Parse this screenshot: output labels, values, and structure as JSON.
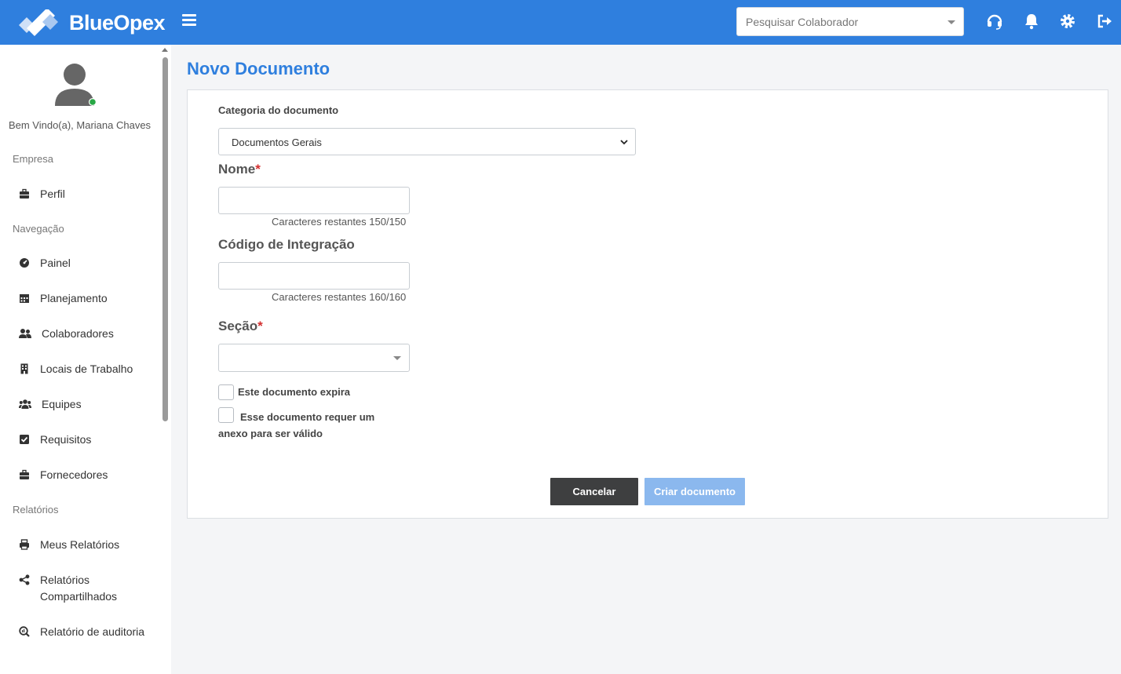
{
  "brand": {
    "name": "BlueOpex"
  },
  "header": {
    "search": {
      "placeholder": "Pesquisar Colaborador"
    },
    "icons": [
      "headset-icon",
      "bell-icon",
      "gear-icon",
      "logout-icon"
    ]
  },
  "sidebar": {
    "welcome": "Bem Vindo(a), Mariana Chaves",
    "sections": {
      "empresa": "Empresa",
      "navegacao": "Navegação",
      "relatorios": "Relatórios"
    },
    "items": {
      "perfil": "Perfil",
      "painel": "Painel",
      "planejamento": "Planejamento",
      "colaboradores": "Colaboradores",
      "locais": "Locais de Trabalho",
      "equipes": "Equipes",
      "requisitos": "Requisitos",
      "fornecedores": "Fornecedores",
      "meus_relatorios": "Meus Relatórios",
      "relatorios_compartilhados": "Relatórios Compartilhados",
      "relatorio_auditoria": "Relatório de auditoria"
    },
    "status_color": "#28a745"
  },
  "main": {
    "title": "Novo Documento",
    "form": {
      "categoria_label": "Categoria do documento",
      "categoria_value": "Documentos Gerais",
      "nome_label": "Nome",
      "nome_hint": "Caracteres restantes 150/150",
      "codigo_label": "Código de Integração",
      "codigo_hint": "Caracteres restantes 160/160",
      "secao_label": "Seção",
      "required_mark": "*",
      "expira_label": "Este documento expira",
      "anexo_label": "Esse documento requer um anexo para ser válido"
    },
    "buttons": {
      "cancel": "Cancelar",
      "create": "Criar documento"
    }
  },
  "colors": {
    "primary": "#2f7fde",
    "cancel_button": "#3e3f40",
    "create_button": "#8bb8ee"
  }
}
